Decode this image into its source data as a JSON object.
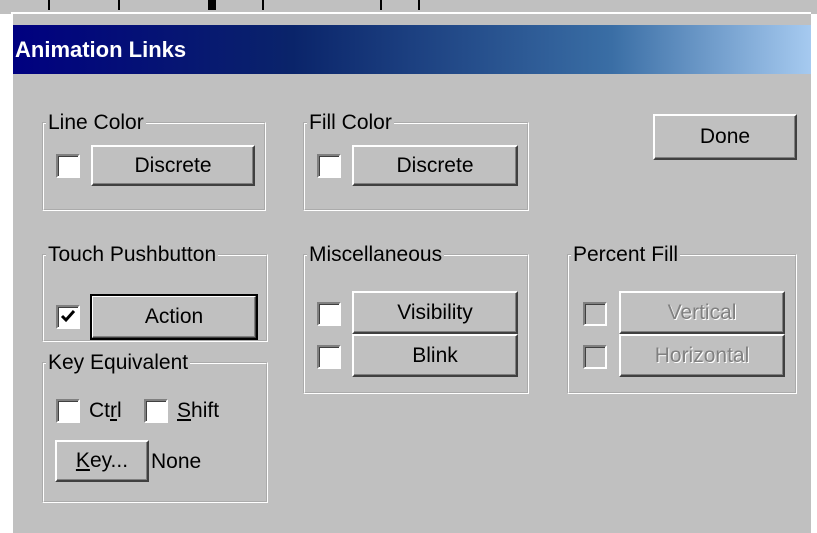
{
  "window": {
    "title": "Animation Links"
  },
  "line_color": {
    "legend": "Line Color",
    "checked": false,
    "button": "Discrete"
  },
  "fill_color": {
    "legend": "Fill Color",
    "checked": false,
    "button": "Discrete"
  },
  "done_button": "Done",
  "touch_pushbutton": {
    "legend": "Touch Pushbutton",
    "checked": true,
    "button": "Action"
  },
  "miscellaneous": {
    "legend": "Miscellaneous",
    "visibility": {
      "checked": false,
      "button": "Visibility"
    },
    "blink": {
      "checked": false,
      "button": "Blink"
    }
  },
  "percent_fill": {
    "legend": "Percent Fill",
    "vertical": {
      "checked": false,
      "button": "Vertical",
      "enabled": false
    },
    "horizontal": {
      "checked": false,
      "button": "Horizontal",
      "enabled": false
    }
  },
  "key_equivalent": {
    "legend": "Key Equivalent",
    "ctrl": {
      "checked": false,
      "label_pre": "Ct",
      "label_u": "r",
      "label_post": "l"
    },
    "shift": {
      "checked": false,
      "label_pre": "",
      "label_u": "S",
      "label_post": "hift"
    },
    "key_button": {
      "label_u": "K",
      "label_post": "ey..."
    },
    "value": "None"
  },
  "colors": {
    "face": "#c0c0c0",
    "title_start": "#000080",
    "title_end": "#a6caf0",
    "disabled_text": "#808080"
  }
}
